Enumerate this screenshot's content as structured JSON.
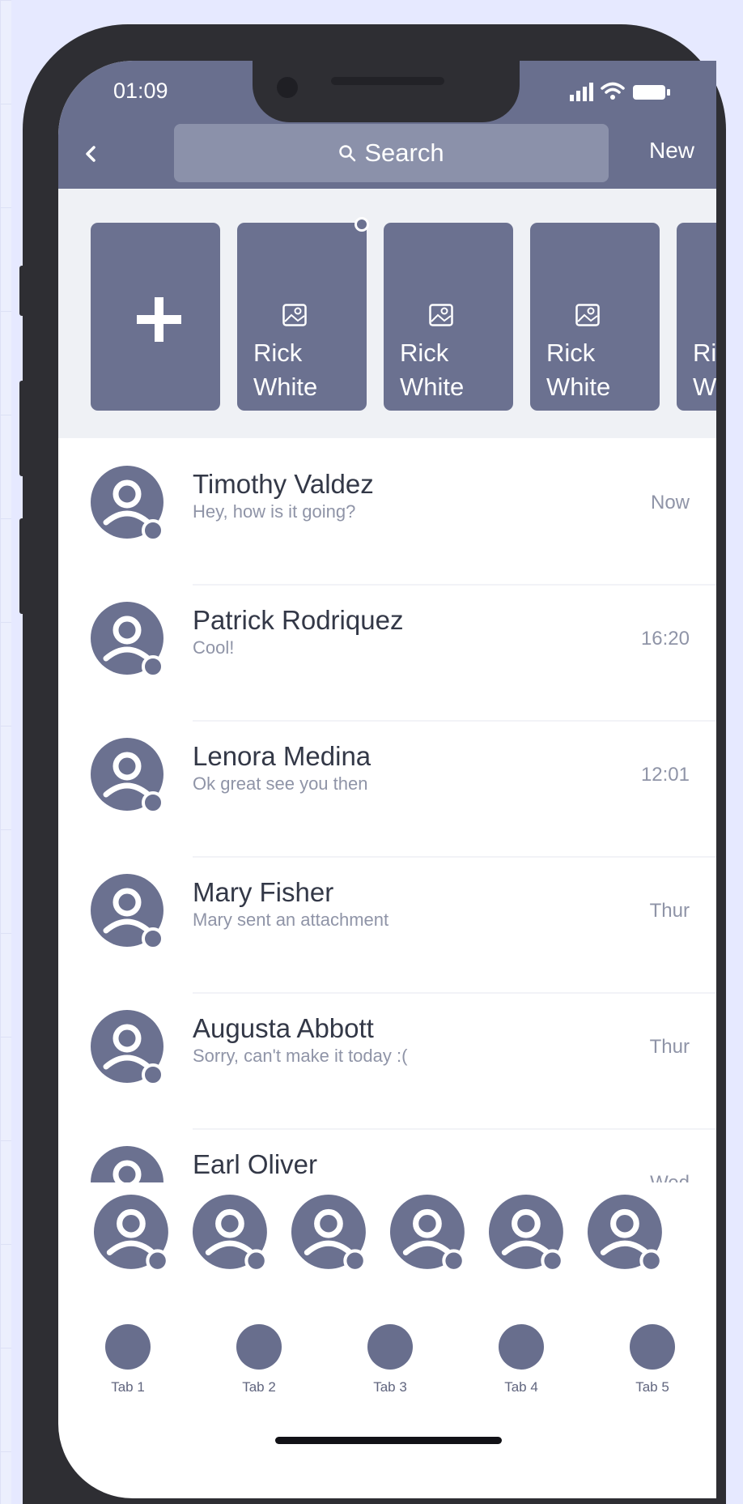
{
  "colors": {
    "accent": "#696f8e",
    "card": "#6b7190",
    "text_primary": "#333847",
    "text_secondary": "#8f94a7",
    "canvas": "#e6e9ff"
  },
  "status_bar": {
    "time": "01:09",
    "icons": [
      "signal-icon",
      "wifi-icon",
      "battery-icon"
    ]
  },
  "nav": {
    "back_icon": "chevron-left-icon",
    "search_placeholder": "Search",
    "search_icon": "search-icon",
    "new_label": "New"
  },
  "stories": {
    "add_icon": "plus-icon",
    "items": [
      {
        "first": "Rick",
        "last": "White",
        "icon": "image-icon"
      },
      {
        "first": "Rick",
        "last": "White",
        "icon": "image-icon"
      },
      {
        "first": "Rick",
        "last": "White",
        "icon": "image-icon"
      },
      {
        "first": "Ri",
        "last": "W",
        "icon": "image-icon"
      }
    ]
  },
  "chats": [
    {
      "name": "Timothy Valdez",
      "preview": "Hey, how is it going?",
      "time": "Now"
    },
    {
      "name": "Patrick Rodriquez",
      "preview": "Cool!",
      "time": "16:20"
    },
    {
      "name": "Lenora Medina",
      "preview": "Ok great see you then",
      "time": "12:01"
    },
    {
      "name": "Mary Fisher",
      "preview": "Mary sent an attachment",
      "time": "Thur"
    },
    {
      "name": "Augusta Abbott",
      "preview": "Sorry, can't make it today :(",
      "time": "Thur"
    },
    {
      "name": "Earl Oliver",
      "preview": "",
      "time": "Wed"
    }
  ],
  "tabs": [
    "Tab 1",
    "Tab 2",
    "Tab 3",
    "Tab 4",
    "Tab 5"
  ]
}
